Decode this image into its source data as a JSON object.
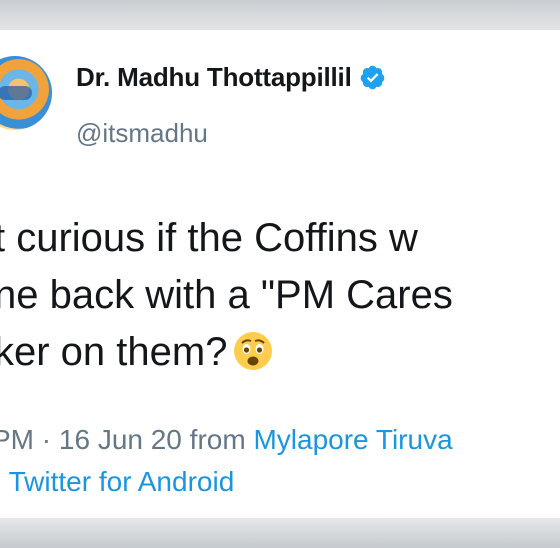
{
  "tweet": {
    "author_name": "Dr. Madhu Thottappillil",
    "handle": "@itsmadhu",
    "text_lines": [
      "t curious if the Coffins w",
      "ne back with a \"PM Cares",
      "ker on them?"
    ],
    "meta": {
      "time_fragment": "PM",
      "separator": " · ",
      "date": "16 Jun 20",
      "from_label": " from ",
      "location": "Mylapore Tiruva",
      "line2_prefix": "· ",
      "source": "Twitter for Android"
    },
    "icons": {
      "verified": "verified-badge-icon",
      "emoji": "anguished-face-emoji"
    },
    "colors": {
      "verified": "#1da1f2",
      "link": "#1b95e0",
      "secondary_text": "#657786",
      "primary_text": "#14171a"
    }
  }
}
